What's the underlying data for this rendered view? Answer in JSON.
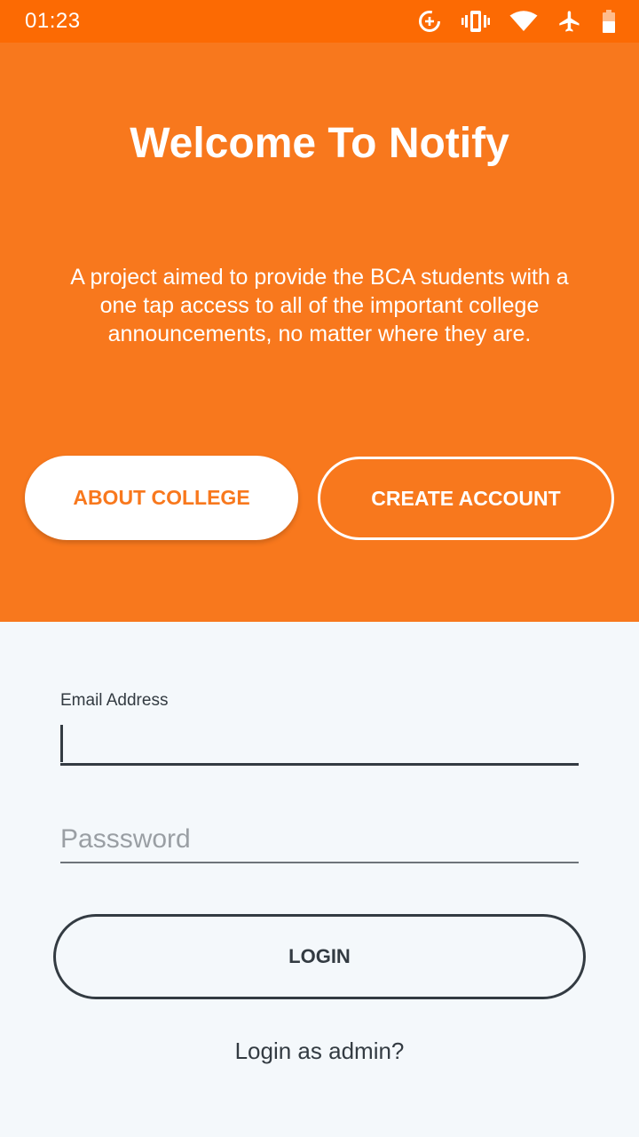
{
  "status_bar": {
    "time": "01:23",
    "icons": [
      "data-saver-icon",
      "vibrate-icon",
      "wifi-icon",
      "airplane-mode-icon",
      "battery-icon"
    ],
    "color": "#fc6a03"
  },
  "hero": {
    "title": "Welcome To Notify",
    "description": "A project aimed to provide the BCA students with a one tap access to all of the important college announcements, no matter where they are.",
    "about_button": "ABOUT COLLEGE",
    "create_button": "CREATE ACCOUNT",
    "color": "#f8781d"
  },
  "login": {
    "email_label": "Email Address",
    "email_value": "",
    "password_placeholder": "Passsword",
    "login_button": "LOGIN",
    "admin_link": "Login as admin?",
    "text_color": "#333b42"
  }
}
